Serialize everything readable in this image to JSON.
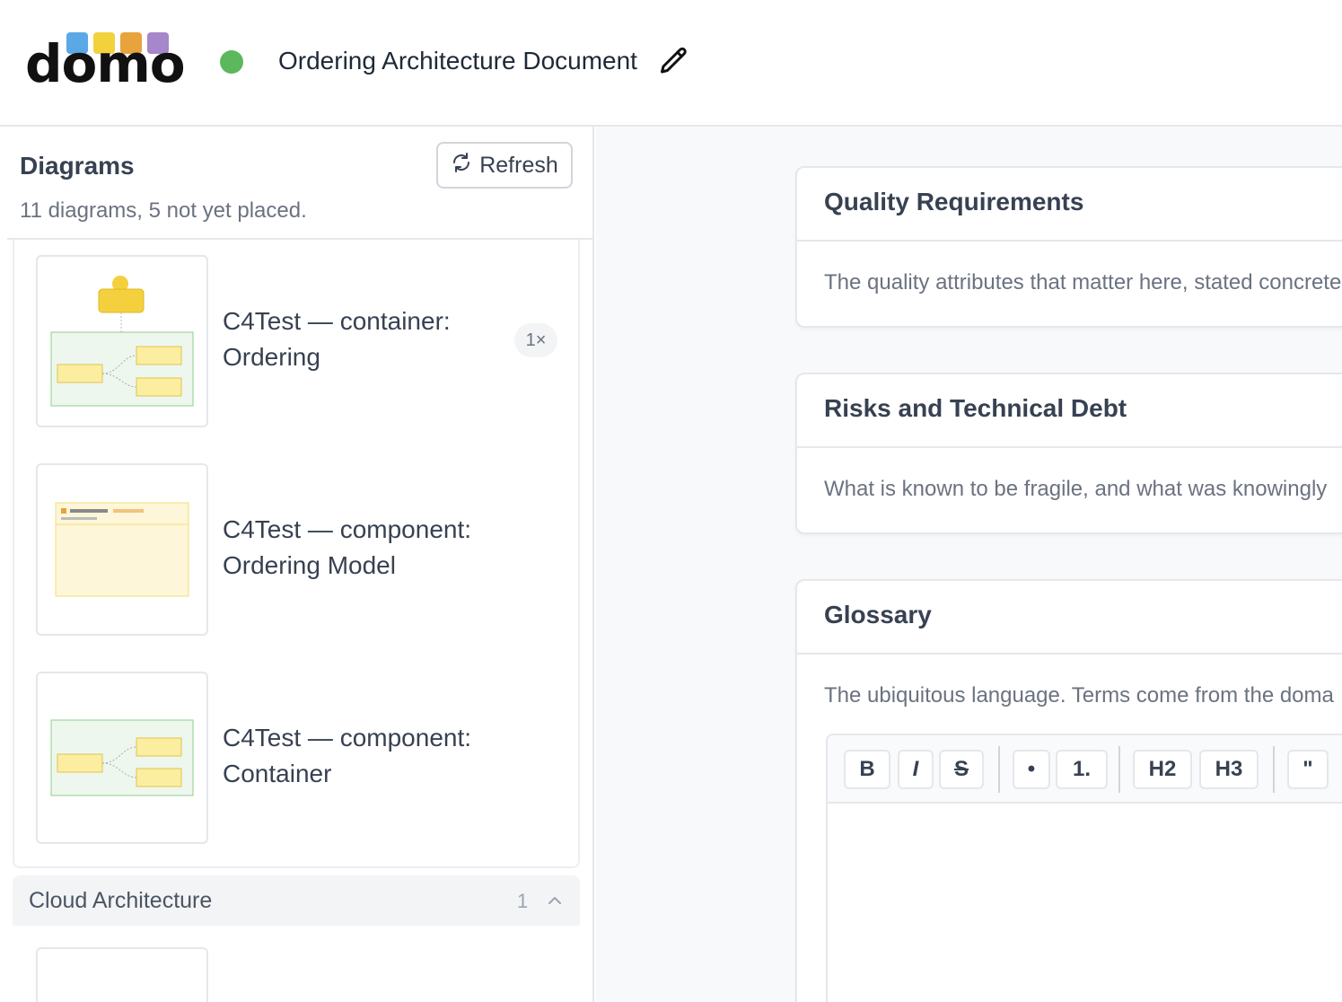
{
  "header": {
    "logo_text": "domo",
    "logo_colors": [
      "#5aa9e6",
      "#f2d13c",
      "#e8a33d",
      "#a687c9"
    ],
    "status_color": "#5cb85c",
    "title": "Ordering Architecture Document",
    "edit_icon": "pencil-icon"
  },
  "sidebar": {
    "title": "Diagrams",
    "subtitle": "11 diagrams, 5 not yet placed.",
    "refresh_label": "Refresh",
    "refresh_icon": "refresh-icon",
    "diagrams": [
      {
        "label": "C4Test — container: Ordering",
        "badge": "1×"
      },
      {
        "label": "C4Test — component: Ordering Model"
      },
      {
        "label": "C4Test — component: Container"
      }
    ],
    "group": {
      "name": "Cloud Architecture",
      "count": "1",
      "icon": "chevron-up-icon"
    }
  },
  "main": {
    "sections": [
      {
        "title": "Quality Requirements",
        "description": "The quality attributes that matter here, stated concrete"
      },
      {
        "title": "Risks and Technical Debt",
        "description": "What is known to be fragile, and what was knowingly"
      },
      {
        "title": "Glossary",
        "description": "The ubiquitous language. Terms come from the doma"
      }
    ],
    "toolbar": {
      "bold": "B",
      "italic": "I",
      "strike": "S",
      "bullet": "•",
      "ordered": "1.",
      "h2": "H2",
      "h3": "H3",
      "quote": "\""
    }
  }
}
